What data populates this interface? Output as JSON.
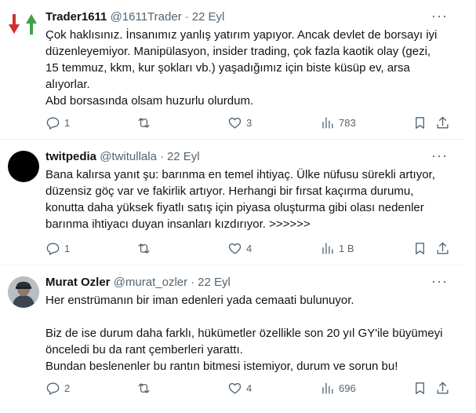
{
  "tweets": [
    {
      "name": "Trader1611",
      "handle": "@1611Trader",
      "separator": "·",
      "date": "22 Eyl",
      "more_label": "···",
      "avatar_icon": "red-green-arrows-icon",
      "lines": [
        "Çok haklısınız. İnsanımız yanlış yatırım yapıyor. Ancak devlet de borsayı iyi",
        "düzenleyemiyor. Manipülasyon, insider trading, çok fazla kaotik olay (gezi,",
        "15 temmuz, kkm, kur şokları vb.) yaşadığımız için biste küsüp ev, arsa",
        "alıyorlar.",
        "Abd borsasında olsam huzurlu olurdum."
      ],
      "replies": "1",
      "retweets": "",
      "likes": "3",
      "views": "783"
    },
    {
      "name": "twitpedia",
      "handle": "@twitullala",
      "separator": "·",
      "date": "22 Eyl",
      "more_label": "···",
      "avatar_icon": "black-circle-avatar",
      "lines": [
        "Bana kalırsa yanıt şu: barınma en temel ihtiyaç. Ülke nüfusu sürekli artıyor,",
        "düzensiz göç var ve fakirlik artıyor. Herhangi bir fırsat kaçırma durumu,",
        "konutta daha yüksek fiyatlı satış için piyasa oluşturma gibi olası nedenler",
        "barınma ihtiyacı duyan insanları kızdırıyor. >>>>>>"
      ],
      "replies": "1",
      "retweets": "",
      "likes": "4",
      "views": "1 B"
    },
    {
      "name": "Murat Ozler",
      "handle": "@murat_ozler",
      "separator": "·",
      "date": "22 Eyl",
      "more_label": "···",
      "avatar_icon": "profile-photo-avatar",
      "lines": [
        "Her enstrümanın bir iman edenleri yada cemaati bulunuyor.",
        "",
        "Biz de ise durum daha farklı, hükümetler özellikle son 20 yıl GY'ile büyümeyi",
        "önceledi bu da rant çemberleri yarattı.",
        "Bundan beslenenler bu rantın bitmesi istemiyor, durum ve sorun bu!"
      ],
      "replies": "2",
      "retweets": "",
      "likes": "4",
      "views": "696"
    }
  ]
}
